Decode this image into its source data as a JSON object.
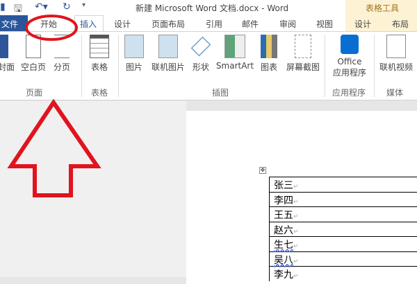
{
  "title": "新建 Microsoft Word 文档.docx - Word",
  "contextual_tools": "表格工具",
  "tabs": {
    "file": "文件",
    "home": "开始",
    "insert": "插入",
    "design": "设计",
    "layout": "页面布局",
    "references": "引用",
    "mailings": "邮件",
    "review": "审阅",
    "view": "视图",
    "table_design": "设计",
    "table_layout": "布局"
  },
  "ribbon": {
    "cover": "封面",
    "blank": "空白页",
    "break": "分页",
    "table": "表格",
    "picture": "图片",
    "online_picture": "联机图片",
    "shapes": "形状",
    "smartart": "SmartArt",
    "chart": "图表",
    "screenshot": "屏幕截图",
    "office1": "Office",
    "office2": "应用程序",
    "online_video": "联机视频",
    "groups": {
      "pages": "页面",
      "tables": "表格",
      "illustrations": "插图",
      "apps": "应用程序",
      "media": "媒体"
    }
  },
  "table_rows": [
    "张三",
    "李四",
    "王五",
    "赵六",
    "生七",
    "吴八",
    "李九"
  ],
  "colors": {
    "accent": "#2b579a",
    "annotation": "#e0141e"
  }
}
